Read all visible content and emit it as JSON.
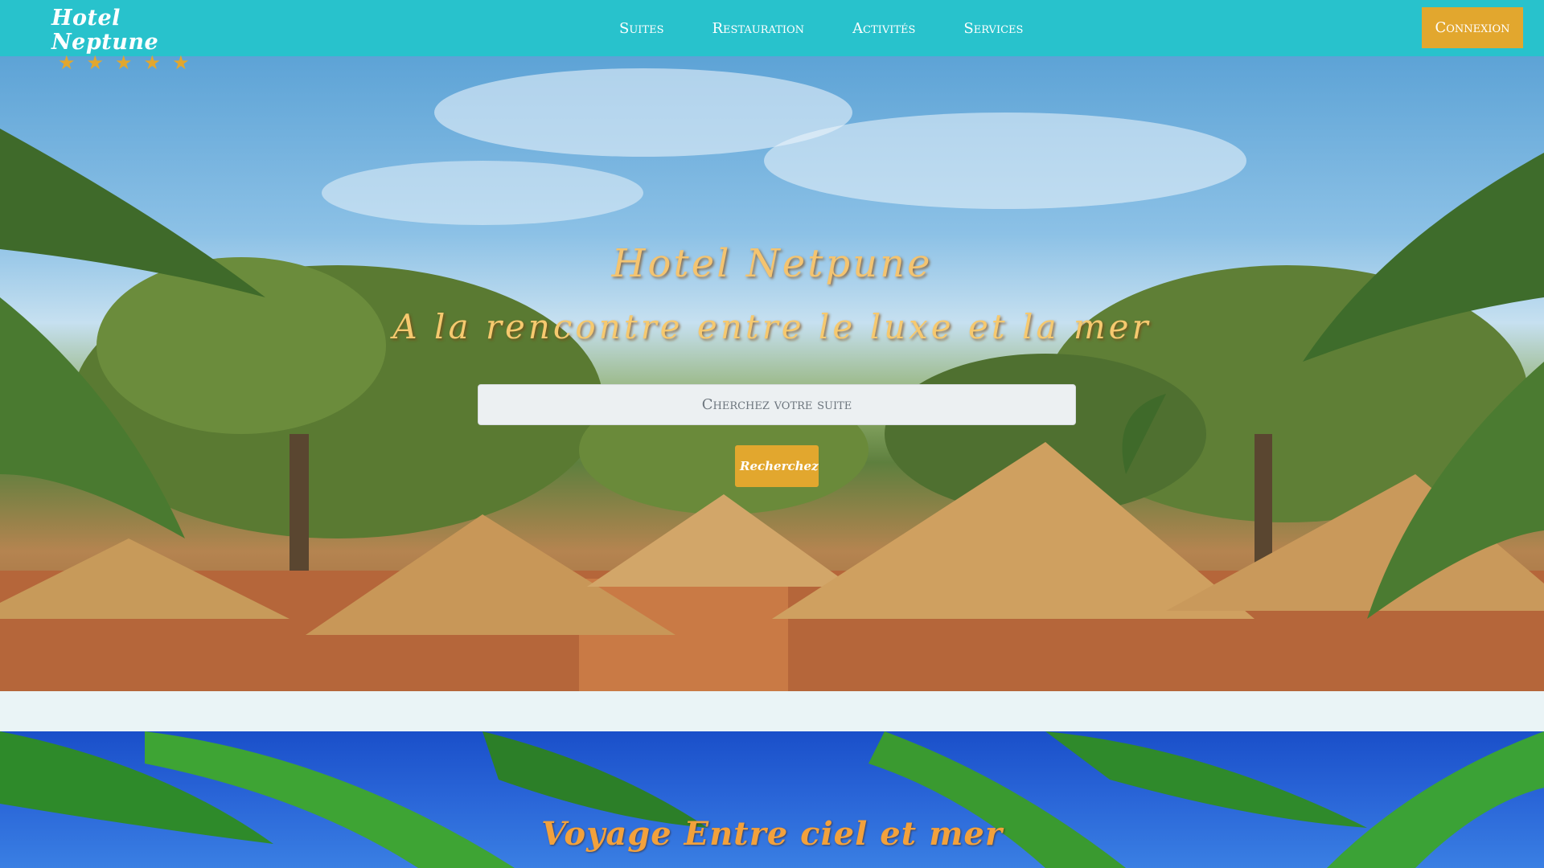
{
  "navbar": {
    "brand_name": "Hotel Neptune",
    "stars": [
      "★",
      "★",
      "★",
      "★",
      "★"
    ],
    "links": [
      "Suites",
      "Restauration",
      "Activités",
      "Services"
    ],
    "login_label": "Connexion"
  },
  "hero": {
    "title": "Hotel Netpune",
    "subtitle": "A la rencontre entre le luxe et la mer",
    "search_placeholder": "Cherchez votre suite",
    "search_button_label": "Recherchez"
  },
  "section2": {
    "title": "Voyage Entre ciel et mer"
  },
  "colors": {
    "navbar_bg": "#28c2cc",
    "accent_gold": "#e2a72e",
    "hero_title": "#f4c470",
    "section2_bg": "#1a4fc9"
  }
}
